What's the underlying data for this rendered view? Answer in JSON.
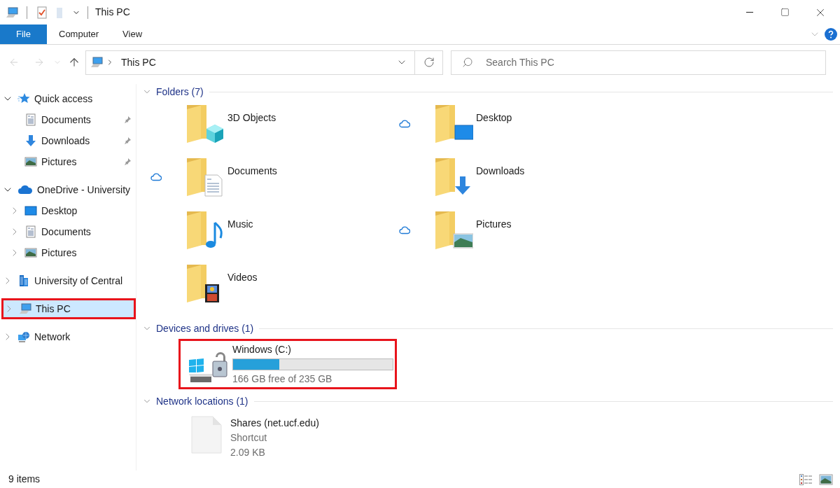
{
  "window": {
    "title": "This PC"
  },
  "ribbon": {
    "tabs": [
      {
        "label": "File",
        "kind": "file"
      },
      {
        "label": "Computer",
        "kind": "tab"
      },
      {
        "label": "View",
        "kind": "tab"
      }
    ]
  },
  "address": {
    "path": "This PC"
  },
  "search": {
    "placeholder": "Search This PC"
  },
  "sidebar": [
    {
      "label": "Quick access",
      "kind": "star",
      "expanded": true,
      "selected": false,
      "outlined": false,
      "children": [
        {
          "label": "Documents",
          "kind": "document",
          "pinned": true,
          "selected": false
        },
        {
          "label": "Downloads",
          "kind": "download",
          "pinned": true,
          "selected": false
        },
        {
          "label": "Pictures",
          "kind": "picture",
          "pinned": true,
          "selected": false
        }
      ]
    },
    {
      "label": "OneDrive - University",
      "kind": "cloud",
      "expanded": true,
      "selected": false,
      "outlined": false,
      "children": [
        {
          "label": "Desktop",
          "kind": "desktop",
          "expanded": false,
          "selected": false
        },
        {
          "label": "Documents",
          "kind": "document",
          "expanded": false,
          "selected": false
        },
        {
          "label": "Pictures",
          "kind": "picture",
          "expanded": false,
          "selected": false
        }
      ]
    },
    {
      "label": "University of Central",
      "kind": "building",
      "expanded": false,
      "selected": false,
      "outlined": false
    },
    {
      "label": "This PC",
      "kind": "pc",
      "expanded": false,
      "selected": true,
      "outlined": true
    },
    {
      "label": "Network",
      "kind": "network",
      "expanded": false,
      "selected": false,
      "outlined": false
    }
  ],
  "sections": [
    {
      "title": "Folders (7)",
      "kind": "folders",
      "expanded": true,
      "items": [
        {
          "name": "3D Objects",
          "kind": "cube",
          "cloud": false
        },
        {
          "name": "Desktop",
          "kind": "desktop",
          "cloud": true
        },
        {
          "name": "Documents",
          "kind": "document",
          "cloud": true
        },
        {
          "name": "Downloads",
          "kind": "download",
          "cloud": false
        },
        {
          "name": "Music",
          "kind": "music",
          "cloud": false
        },
        {
          "name": "Pictures",
          "kind": "picture",
          "cloud": true
        },
        {
          "name": "Videos",
          "kind": "video",
          "cloud": false
        }
      ]
    },
    {
      "title": "Devices and drives (1)",
      "kind": "drives",
      "expanded": true,
      "items": [
        {
          "name": "Windows (C:)",
          "level": 0.29,
          "free": "166 GB free of 235 GB",
          "outlined": true
        }
      ]
    },
    {
      "title": "Network locations (1)",
      "kind": "files",
      "expanded": true,
      "items": [
        {
          "name": "Shares (net.ucf.edu)",
          "type": "Shortcut",
          "size": "2.09 KB"
        }
      ]
    }
  ],
  "status_bar": {
    "count": "9 items"
  }
}
